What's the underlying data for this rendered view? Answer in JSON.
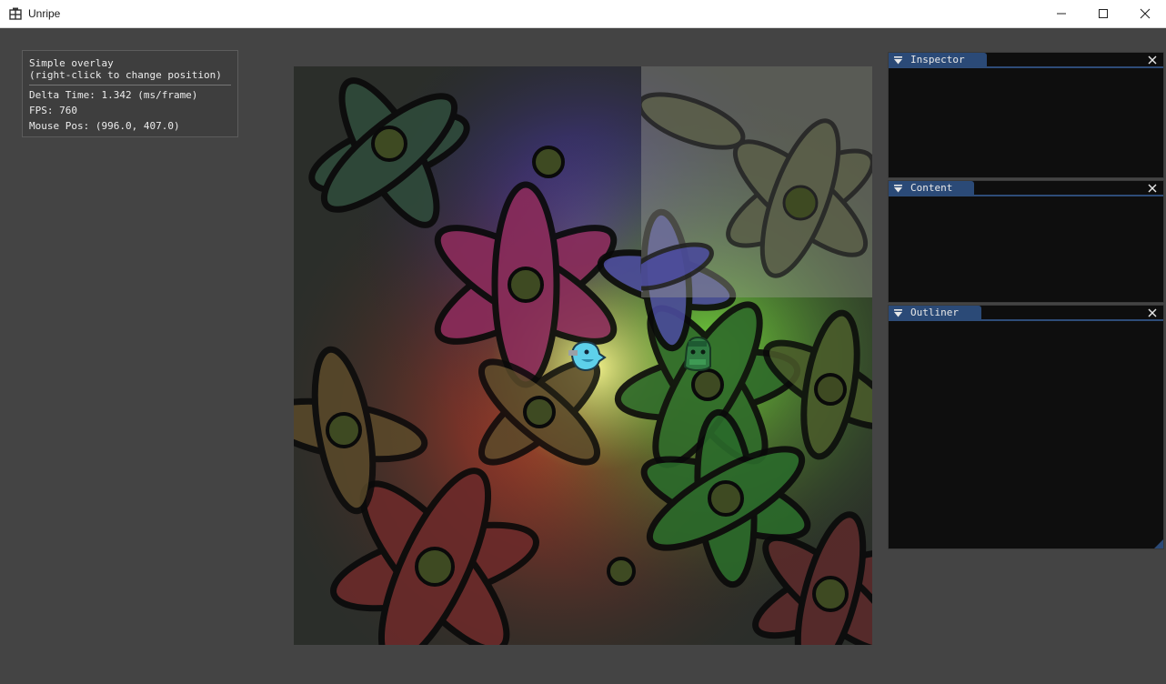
{
  "window": {
    "title": "Unripe",
    "app_icon": "app-grid-icon",
    "controls": [
      "minimize-icon",
      "maximize-icon",
      "close-icon"
    ]
  },
  "overlay": {
    "title": "Simple overlay",
    "hint": "(right-click to change position)",
    "delta_time": "Delta Time: 1.342 (ms/frame)",
    "fps": "FPS: 760",
    "mouse_pos": "Mouse Pos: (996.0, 407.0)"
  },
  "panels": {
    "inspector": {
      "title": "Inspector"
    },
    "content": {
      "title": "Content"
    },
    "outliner": {
      "title": "Outliner"
    }
  },
  "colors": {
    "background": "#444444",
    "panel_bg": "#0e0e0e",
    "tab_active": "#2b4a77",
    "tab_underline": "#2e4c78"
  }
}
